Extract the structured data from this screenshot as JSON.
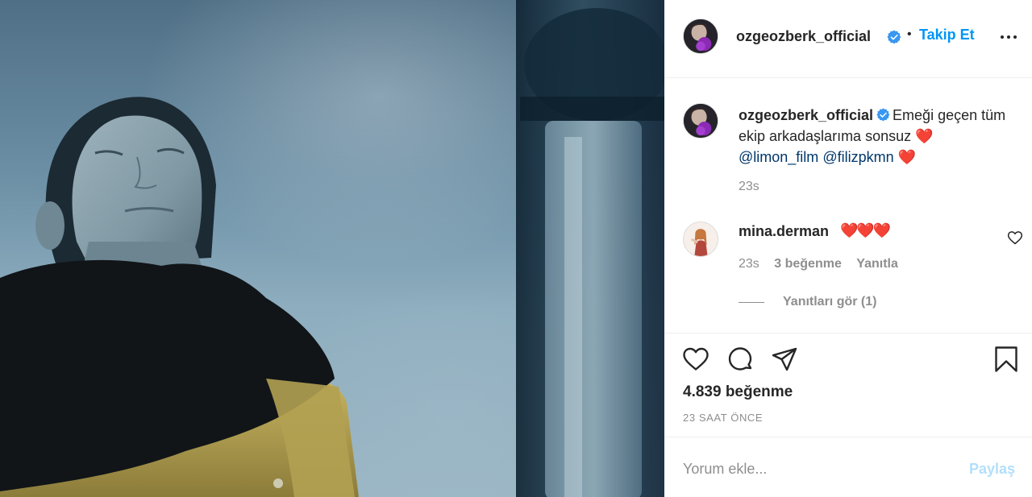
{
  "post": {
    "author": "ozgeozberk_official",
    "follow_label": "Takip Et",
    "dot": "•",
    "caption": {
      "author": "ozgeozberk_official",
      "text": "Emeği geçen tüm ekip arkadaşlarıma sonsuz",
      "heart1": "❤️",
      "mention1": "@limon_film",
      "mention2": "@filizpkmn",
      "heart2": "❤️",
      "time": "23s"
    },
    "comments": [
      {
        "user": "mina.derman",
        "text": "❤️❤️❤️",
        "time": "23s",
        "likes": "3 beğenme",
        "reply_label": "Yanıtla",
        "view_replies": "Yanıtları gör (1)"
      }
    ],
    "like_count": "4.839 beğenme",
    "time_ago": "23 SAAT ÖNCE",
    "add_comment": {
      "placeholder": "Yorum ekle...",
      "post_label": "Paylaş"
    }
  },
  "icons": {
    "verified": "verified-badge-icon",
    "more": "more-options-icon",
    "like": "heart-icon",
    "comment": "comment-bubble-icon",
    "share": "paper-plane-icon",
    "save": "bookmark-icon"
  },
  "colors": {
    "link_blue": "#0095f6",
    "mention": "#00376b",
    "secondary_text": "#8e8e8e",
    "post_disabled": "#b2dffc",
    "heart_red": "#e0201f"
  }
}
